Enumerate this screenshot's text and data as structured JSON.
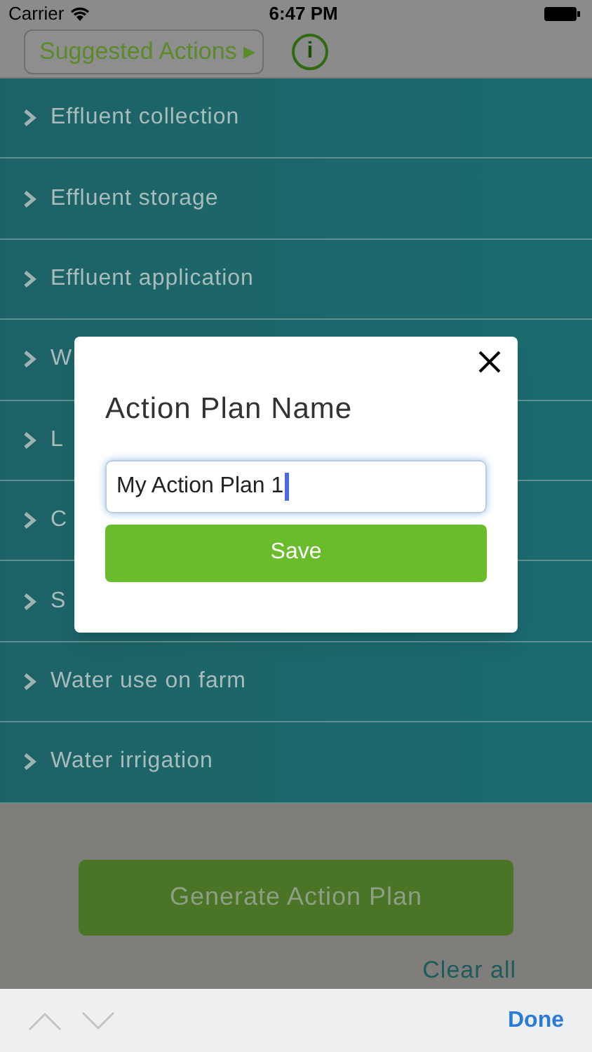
{
  "status_bar": {
    "carrier": "Carrier",
    "time": "6:47 PM"
  },
  "header": {
    "suggested_button": "Suggested Actions ▸",
    "info_icon_text": "i"
  },
  "categories": [
    {
      "label": "Effluent collection"
    },
    {
      "label": "Effluent storage"
    },
    {
      "label": "Effluent application"
    },
    {
      "label": "W"
    },
    {
      "label": "L"
    },
    {
      "label": "C"
    },
    {
      "label": "S"
    },
    {
      "label": "Water use on farm"
    },
    {
      "label": "Water irrigation"
    }
  ],
  "generate_button": "Generate Action Plan",
  "clear_all": "Clear all",
  "dialog": {
    "title": "Action Plan Name",
    "value": "My Action Plan 1",
    "save_button": "Save"
  },
  "keyboard_bar": {
    "done": "Done"
  }
}
